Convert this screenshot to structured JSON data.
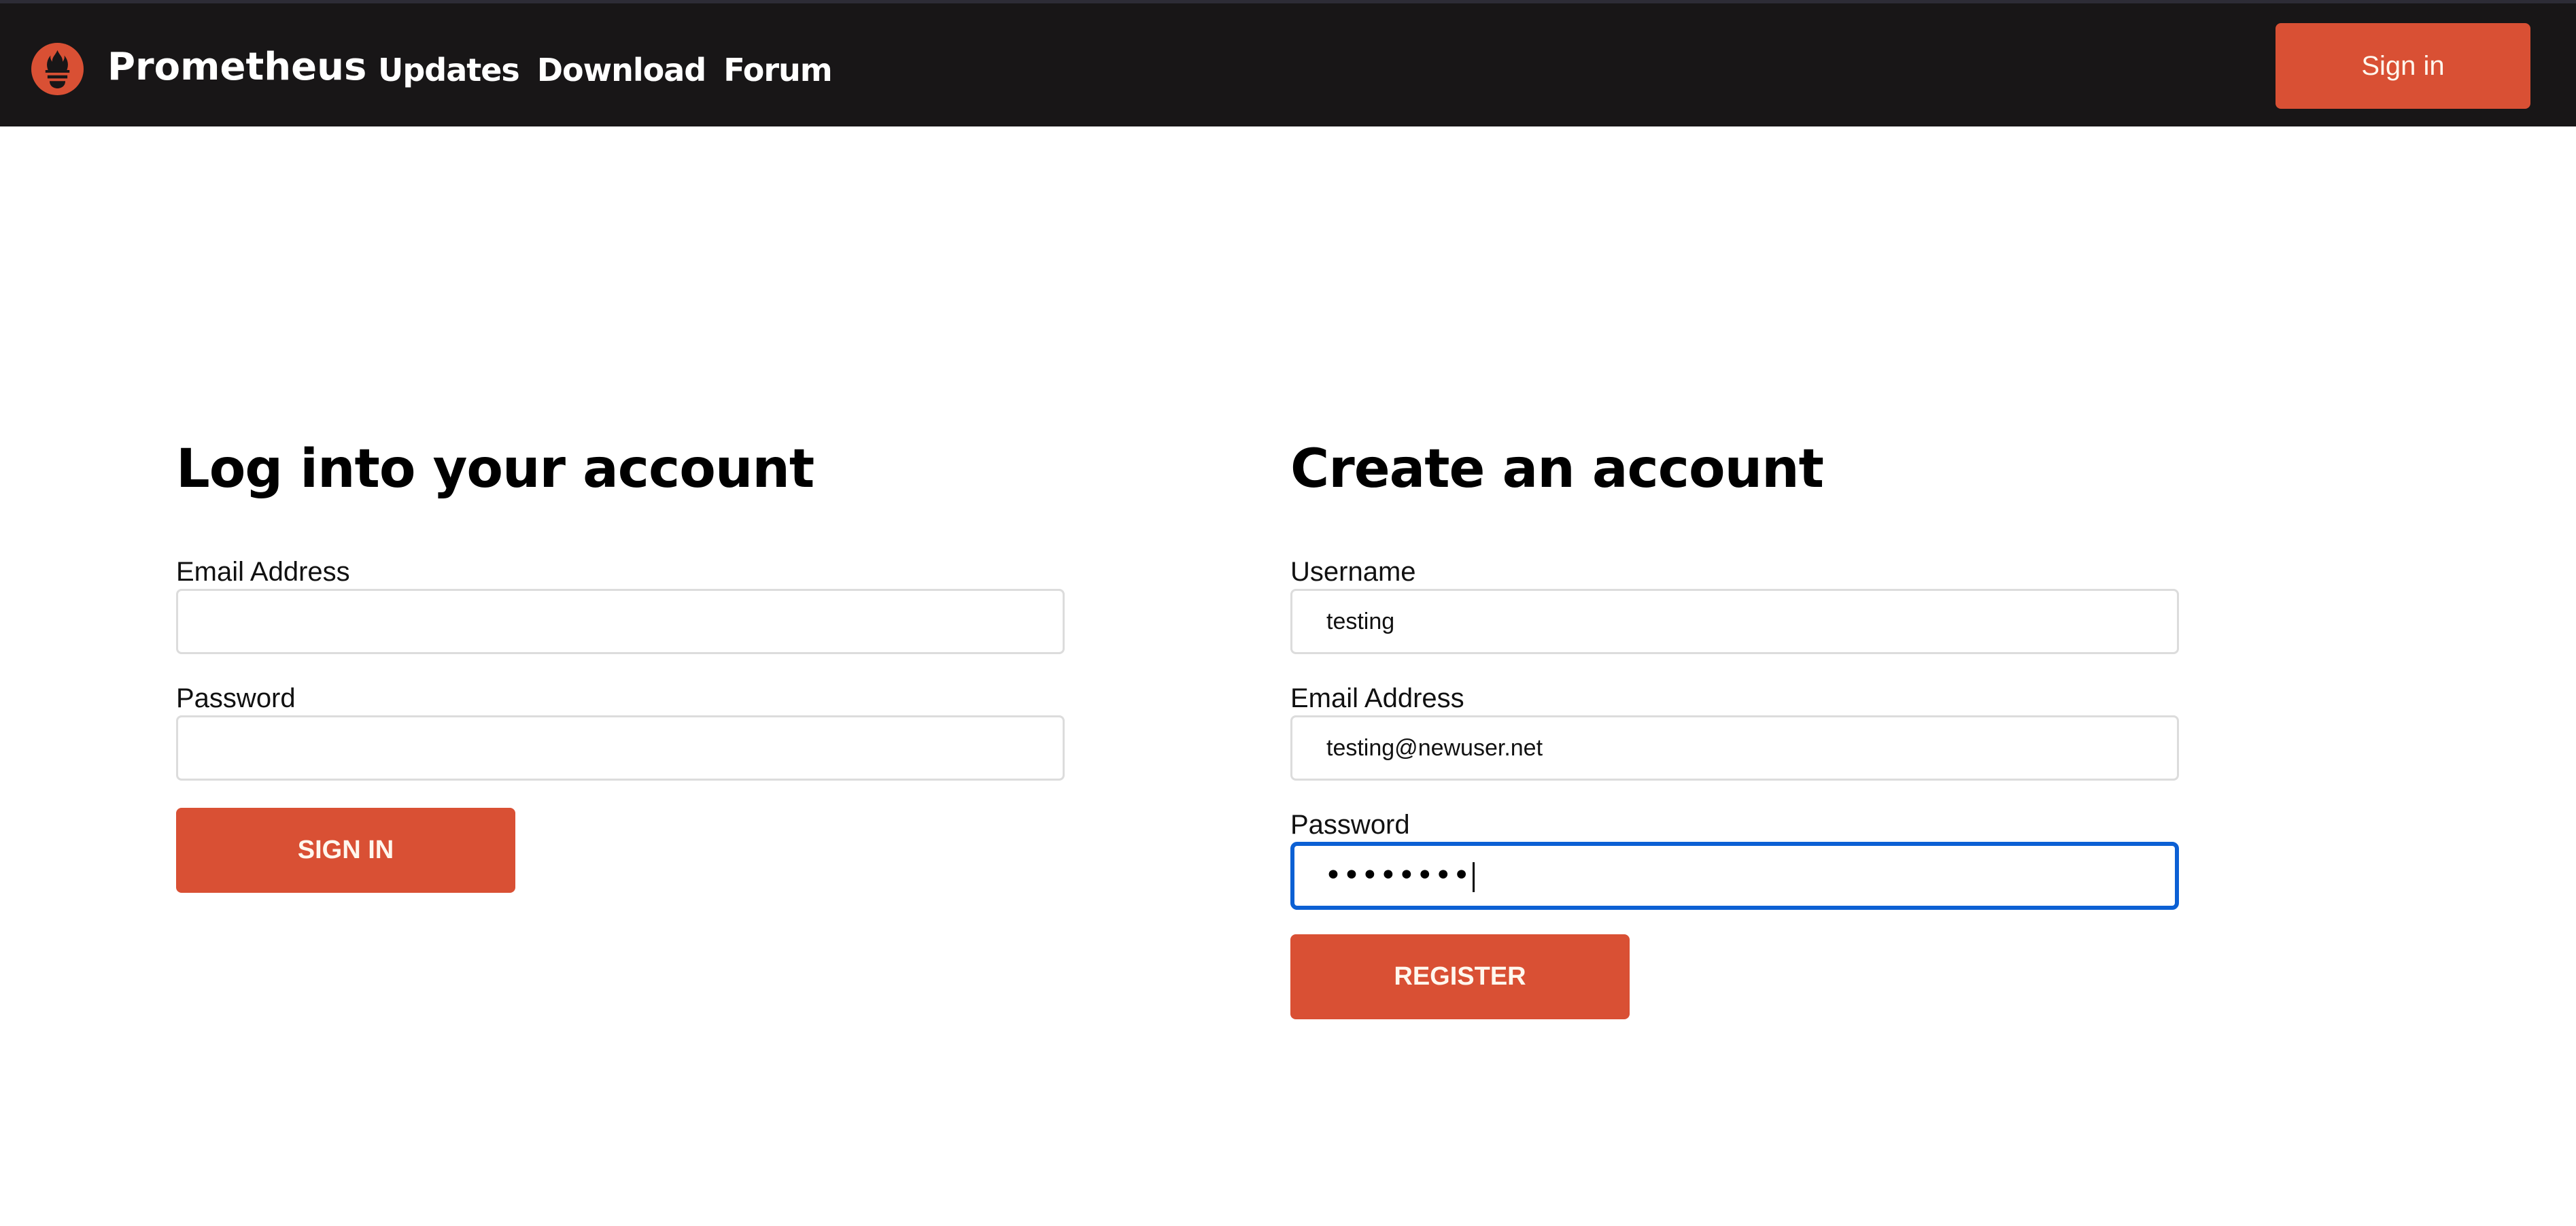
{
  "colors": {
    "header_bg": "#181617",
    "accent": "#d95034",
    "focus_ring": "#0c60d4",
    "input_border": "#dcdcdc"
  },
  "header": {
    "logo_icon": "prometheus-torch-icon",
    "brand": "Prometheus",
    "nav": [
      {
        "label": "Updates"
      },
      {
        "label": "Download"
      },
      {
        "label": "Forum"
      }
    ],
    "signin_label": "Sign in"
  },
  "login": {
    "title": "Log into your account",
    "email_label": "Email Address",
    "email_value": "",
    "password_label": "Password",
    "password_value": "",
    "submit_label": "SIGN IN"
  },
  "register": {
    "title": "Create an account",
    "username_label": "Username",
    "username_value": "testing",
    "email_label": "Email Address",
    "email_value": "testing@newuser.net",
    "password_label": "Password",
    "password_masked": "••••••••",
    "password_focused": true,
    "submit_label": "REGISTER"
  }
}
